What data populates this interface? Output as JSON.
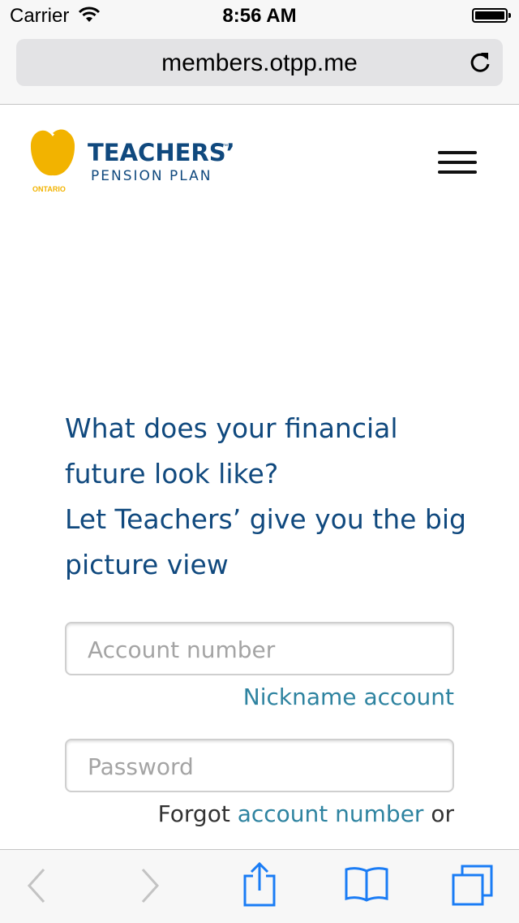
{
  "status_bar": {
    "carrier": "Carrier",
    "time": "8:56 AM"
  },
  "browser": {
    "url": "members.otpp.me"
  },
  "logo": {
    "name_line1": "TEACHERS’",
    "tm": "™",
    "name_line2": "PENSION PLAN",
    "region": "ONTARIO",
    "color_brand": "#10497e",
    "color_apple": "#f2b300"
  },
  "headline": {
    "lines": [
      "What does your financial",
      "future look like?",
      "Let Teachers’ give you the big",
      "picture view"
    ]
  },
  "form": {
    "account_placeholder": "Account number",
    "nickname_link": "Nickname account",
    "password_placeholder": "Password",
    "forgot_prefix": "Forgot",
    "forgot_account_link": "account number",
    "forgot_suffix": "or"
  },
  "toolbar": {
    "icons": [
      "back-icon",
      "forward-icon",
      "share-icon",
      "bookmarks-icon",
      "tabs-icon"
    ]
  },
  "colors": {
    "link": "#2e83a0",
    "ios_blue": "#1a7cf5"
  }
}
